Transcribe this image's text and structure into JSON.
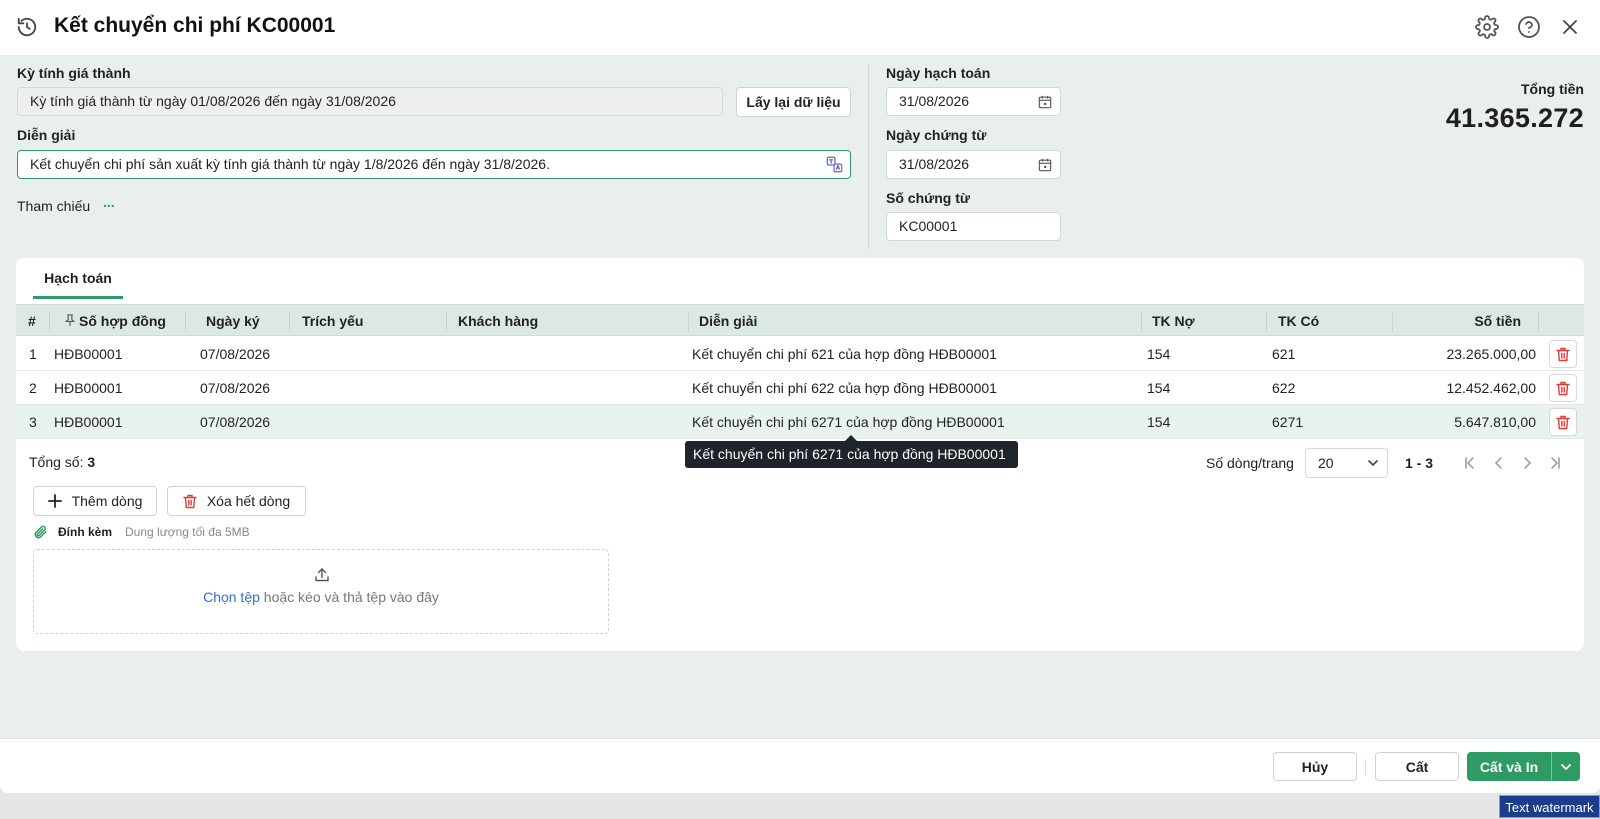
{
  "header": {
    "title": "Kết chuyển chi phí KC00001"
  },
  "form": {
    "period_label": "Kỳ tính giá thành",
    "period_value": "Kỳ tính giá thành từ ngày 01/08/2026 đến ngày 31/08/2026",
    "reload_button": "Lấy lại dữ liệu",
    "description_label": "Diễn giải",
    "description_value": "Kết chuyển chi phí sản xuất kỳ tính giá thành từ ngày 1/8/2026 đến ngày 31/8/2026.",
    "reference_label": "Tham chiếu",
    "reference_more": "...",
    "posting_date_label": "Ngày hạch toán",
    "posting_date_value": "31/08/2026",
    "voucher_date_label": "Ngày chứng từ",
    "voucher_date_value": "31/08/2026",
    "voucher_no_label": "Số chứng từ",
    "voucher_no_value": "KC00001",
    "total_label": "Tổng tiền",
    "total_value": "41.365.272"
  },
  "tabs": {
    "active": "Hạch toán"
  },
  "table": {
    "columns": {
      "index": "#",
      "contract_no": "Số hợp đồng",
      "sign_date": "Ngày ký",
      "summary": "Trích yếu",
      "customer": "Khách hàng",
      "description": "Diễn giải",
      "debit": "TK Nợ",
      "credit": "TK Có",
      "amount": "Số tiền"
    },
    "rows": [
      {
        "index": "1",
        "contract_no": "HĐB00001",
        "sign_date": "07/08/2026",
        "summary": "",
        "customer": "",
        "description": "Kết chuyển chi phí 621 của hợp đồng HĐB00001",
        "debit": "154",
        "credit": "621",
        "amount": "23.265.000,00"
      },
      {
        "index": "2",
        "contract_no": "HĐB00001",
        "sign_date": "07/08/2026",
        "summary": "",
        "customer": "",
        "description": "Kết chuyển chi phí 622 của hợp đồng HĐB00001",
        "debit": "154",
        "credit": "622",
        "amount": "12.452.462,00"
      },
      {
        "index": "3",
        "contract_no": "HĐB00001",
        "sign_date": "07/08/2026",
        "summary": "",
        "customer": "",
        "description": "Kết chuyển chi phí 6271 của hợp đồng HĐB00001",
        "debit": "154",
        "credit": "6271",
        "amount": "5.647.810,00"
      }
    ],
    "tooltip": "Kết chuyển chi phí 6271 của hợp đồng HĐB00001",
    "total_label": "Tổng số:",
    "total_count": "3",
    "rows_per_page_label": "Số dòng/trang",
    "rows_per_page_value": "20",
    "range": "1 - 3"
  },
  "actions": {
    "add_row": "Thêm dòng",
    "delete_all": "Xóa hết dòng"
  },
  "attachment": {
    "label": "Đính kèm",
    "hint": "Dung lượng tối đa 5MB",
    "choose_link": "Chọn tệp",
    "drop_text": " hoặc kéo và thả tệp vào đây"
  },
  "footer": {
    "cancel": "Hủy",
    "save": "Cất",
    "save_print": "Cất và In"
  },
  "watermark": "Text watermark",
  "colors": {
    "accent": "#2e9b64",
    "danger": "#e53935",
    "link": "#2f6fd6"
  }
}
